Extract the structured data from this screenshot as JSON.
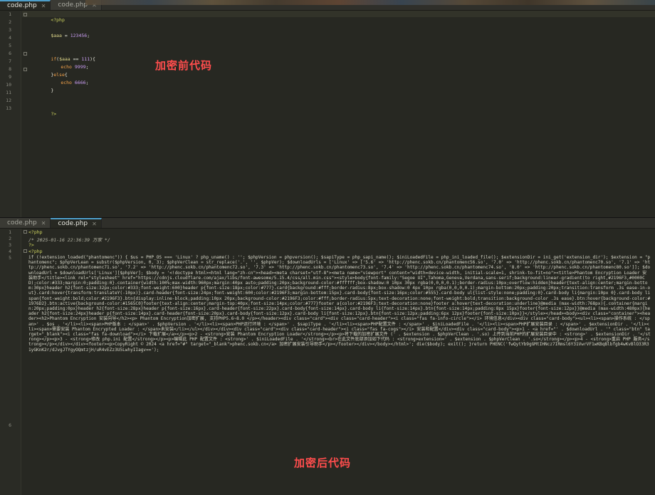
{
  "top_pane": {
    "tabs": [
      {
        "label": "code.php",
        "active": true
      },
      {
        "label": "code.php",
        "active": false
      }
    ],
    "line_numbers": [
      "1",
      "2",
      "3",
      "4",
      "5",
      "6",
      "7",
      "8",
      "9",
      "10",
      "11",
      "12",
      "13"
    ],
    "code": {
      "l1": "<?php",
      "l3_var": "$aaa",
      "l3_op": " = ",
      "l3_num": "123456",
      "l3_end": ";",
      "l5_kw": "if",
      "l5_a": "(",
      "l5_var": "$aaa",
      "l5_b": " == ",
      "l5_num": "111",
      "l5_c": "){",
      "l6_kw": "echo",
      "l6_num": " 9999",
      "l6_end": ";",
      "l7_a": "}",
      "l7_kw": "else",
      "l7_b": "{",
      "l8_kw": "echo",
      "l8_num": " 6666",
      "l8_end": ";",
      "l9": "}",
      "l13": "?>"
    },
    "overlay_label": "加密前代码"
  },
  "bottom_pane": {
    "tabs": [
      {
        "label": "code.php",
        "active": false
      },
      {
        "label": "code.php",
        "active": true
      }
    ],
    "line_numbers": [
      "1",
      "2",
      "3",
      "4",
      "5",
      "6"
    ],
    "code": {
      "l1": "<?php",
      "l2": "/* 2025-01-16 22:36:39 万家 */",
      "l3": "?>",
      "l4": "<?php"
    },
    "dump_text": "if (!extension_loaded(\"phantomenc\")) { $us = PHP_OS === 'Linux' ? php_uname() : ''; $phpVersion = phpversion(); $sapiType = php_sapi_name(); $iniLoadedFile = php_ini_loaded_file(); $extensionDir = ini_get('extension_dir'); $extension = \"phantomenc\"; $phpVerLean = substr($phpVersion, 0, 3); $phpVerClean = str_replace('.', '', $phpVer); $downloadUrls = ['Linux' => ['5.6' => 'http://phenc.sokb.cn/phantomenc56.so', '7.0' => 'http://phenc.sokb.cn/phantomenc70.so', '7.1' => 'http://phenc.sokb.cn/phantomenc71.so', '7.2' => 'http://phenc.sokb.cn/phantomenc72.so', '7.3' => 'http://phenc.sokb.cn/phantomenc73.so', '7.4' => 'http://phenc.sokb.cn/phantomenc74.so', '8.0' => 'http://phenc.sokb.cn/phantomenc80.so']]; $downloadUrl = $downloadUrls['Linux'][$phpVer]; $body = '<!doctype html><html lang=\"zh-cn\"><head><meta charset=\"utf-8\"><meta name=\"viewport\" content=\"width=device-width, initial-scale=1, shrink-to-fit=no\"><title>Phantom Encryption Loader 安装助手</title><link rel=\"stylesheet\" href=\"https://cdnjs.cloudflare.com/ajax/libs/font-awesome/5.15.4/css/all.min.css\"><style>body{font-family:\"Segoe UI\",Tahoma,Geneva,Verdana,sans-serif;background:linear-gradient(to right,#2196F3,#0000CD);color:#333;margin:0;padding:0}.container{width:100%;max-width:960px;margin:40px auto;padding:20px;background-color:#ffffff;box-shadow:0 10px 30px rgba(0,0,0,0.1);border-radius:10px;overflow:hidden}header{text-align:center;margin-bottom:30px}header h2{font-size:32px;color:#333;font-weight:600}header p{font-size:18px;color:#777}.card{background:#fff;border-radius:8px;box-shadow:0 4px 10px rgba(0,0,0,0.1);margin-bottom:20px;padding:20px;transition:transform .3s ease-in-out}.card:hover{transform:translateY(-10px)}.card-header{font-size:24px;font-weight:600;color:#2196F3;margin-bottom:15px}.card-body{font-size:16px;color:#555}.card-body ul{list-style:none;padding:0}.card-body li{margin:10px 0}.card-body li span{font-weight:bold;color:#2196F3}.btn{display:inline-block;padding:10px 20px;background-color:#2196F3;color:#fff;border-radius:5px;text-decoration:none;font-weight:bold;transition:background-color .3s ease}.btn:hover{background-color:#1976D2}.btn:active{background-color:#1565C0}footer{text-align:center;margin-top:40px;font-size:14px;color:#777}footer a{color:#2196F3;text-decoration:none}footer a:hover{text-decoration:underline}@media (max-width:768px){.container{margin:20px;padding:0px}header h2{font-size:28px}header p{font-size:16px}.card-header{font-size:22px}.card-body{font-size:14px}.card-body li{font-size:14px}.btn{font-size:14px;padding:8px 15px}footer{font-size:12px}}@media (max-width:480px){header h2{font-size:24px}header p{font-size:14px}.card-header{font-size:20px}.card-body{font-size:12px}.card-body li{font-size:12px}.btn{font-size:12px;padding:6px 12px}footer{font-size:10px}}</style></head><body><div class=\"container\"><header><h2>Phantom Encryption 安装向导</h2><p> Phantom Encryption加密扩展, 支持PHP5.6~8.0 </p></header><div class=\"card\"><div class=\"card-header\"><i class=\"fas fa-info-circle\"></i> 环境信息</div><div class=\"card-body\"><ul><li><span>操作系统 : </span>' . $os . '</li><li><span>PHP版本 : </span>' . $phpVersion . '</li><li><span>PHP运行环境 : </span>' . $sapiType . '</li><li><span>PHP配置文件 : </span>' . $iniLoadedFile . '</li><li><span>PHP扩展安装目录 : </span>' . $extensionDir . '</li><li><span>需要安装 Phantom Encrypted Loader : </span>未安装</li></ul></div></div><div class=\"card\"><div class=\"card-header\"><i class=\"fas fa-cogs\"></i> 安装和配置</div><div class=\"card-body\"><p>1 - <a href=\"' . $downloadUrl . '\" class=\"btn\" target=\"_blank\"><i class=\"fas fa-download\"></i> 下载扩展</a></p><p>2 - <strong>安装 Phantom Encryption Loader</strong></p><p>将下载的加密扩展文件 (' . $extension . $phpVerClean . '.so) 上传到当前PHP的扩展安装目录中 : <strong>' . $extensionDir . '</strong></p><p>3 - <strong>修改 php.ini 配置</strong></p><p>编辑此 PHP 配置文件 : <strong>' . $iniLoadedFile . '</strong><br>在此文件底部添加如下代码 : <strong>extension=' . $extension . $phpVerClean . '.so</strong></p><p>4 - <strong>重启 PHP 服务</strong></p></div></div><footer><p>CopyRight © 2024 <a href=\"#\" target=\"_blank\">phenc.sokb.cn</a> 加密扩展安装引导助手</p></footer></div></body></html>'; die($body); exit(); }return PHENC('fwQytYb9gGMtIHNcz7IRmsl6Y31VwrVF1wKBqBlbfgb4wKvBlO33R31yGKnK2r/dJvgJTYgyOQmtzjH/uR4vEZz3U5LwhyIIagv==');",
    "overlay_label": "加密后代码"
  }
}
